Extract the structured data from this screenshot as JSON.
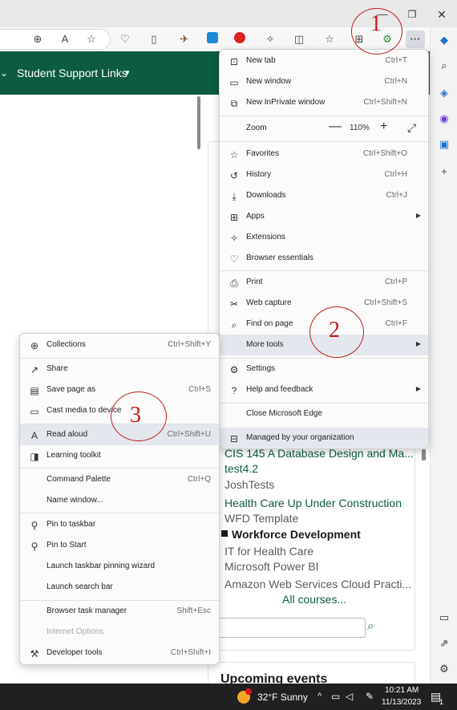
{
  "browser": {
    "toolbar_icons": [
      "zoom-icon",
      "read-aloud-icon",
      "favorite-star-icon",
      "pocket-icon",
      "reader-icon",
      "extension-icon",
      "extension-s-icon",
      "adblock-icon",
      "extensions-puzzle-icon",
      "split-screen-icon",
      "favorites-icon",
      "collections-icon",
      "profile-icon",
      "more-icon"
    ],
    "sidebar_icons": [
      "copilot-icon",
      "search-icon",
      "tag-icon",
      "office-icon",
      "outlook-icon",
      "add-icon",
      "sidebar-toggle-icon",
      "external-icon",
      "settings-icon"
    ],
    "more_button_label": "···"
  },
  "page": {
    "nav_link": "Student Support Links",
    "courses": [
      {
        "text": "CIS 145 A Database Design and Ma...",
        "style": "link"
      },
      {
        "text": "test4.2",
        "style": "link"
      },
      {
        "text": "JoshTests",
        "style": "gray"
      },
      {
        "text": "Health Care Up Under Construction",
        "style": "link"
      },
      {
        "text": "WFD Template",
        "style": "gray"
      },
      {
        "text": "Workforce Development",
        "style": "bold"
      },
      {
        "text": "IT for Health Care",
        "style": "gray"
      },
      {
        "text": "Microsoft Power BI",
        "style": "gray"
      },
      {
        "text": "Amazon Web Services Cloud Practi...",
        "style": "gray"
      }
    ],
    "all_courses": "All courses...",
    "upcoming_events": "Upcoming events"
  },
  "main_menu": {
    "new_tab": {
      "label": "New tab",
      "shortcut": "Ctrl+T"
    },
    "new_window": {
      "label": "New window",
      "shortcut": "Ctrl+N"
    },
    "new_inprivate": {
      "label": "New InPrivate window",
      "shortcut": "Ctrl+Shift+N"
    },
    "zoom": {
      "label": "Zoom",
      "value": "110%"
    },
    "favorites": {
      "label": "Favorites",
      "shortcut": "Ctrl+Shift+O"
    },
    "history": {
      "label": "History",
      "shortcut": "Ctrl+H"
    },
    "downloads": {
      "label": "Downloads",
      "shortcut": "Ctrl+J"
    },
    "apps": {
      "label": "Apps"
    },
    "extensions": {
      "label": "Extensions"
    },
    "browser_essentials": {
      "label": "Browser essentials"
    },
    "print": {
      "label": "Print",
      "shortcut": "Ctrl+P"
    },
    "web_capture": {
      "label": "Web capture",
      "shortcut": "Ctrl+Shift+S"
    },
    "find_on_page": {
      "label": "Find on page",
      "shortcut": "Ctrl+F"
    },
    "more_tools": {
      "label": "More tools"
    },
    "settings": {
      "label": "Settings"
    },
    "help_feedback": {
      "label": "Help and feedback"
    },
    "close_edge": {
      "label": "Close Microsoft Edge"
    },
    "managed": {
      "label": "Managed by your organization"
    }
  },
  "more_tools_menu": {
    "collections": {
      "label": "Collections",
      "shortcut": "Ctrl+Shift+Y"
    },
    "share": {
      "label": "Share"
    },
    "save_page": {
      "label": "Save page as",
      "shortcut": "Ctrl+S"
    },
    "cast": {
      "label": "Cast media to device"
    },
    "read_aloud": {
      "label": "Read aloud",
      "shortcut": "Ctrl+Shift+U"
    },
    "learning_toolkit": {
      "label": "Learning toolkit"
    },
    "command_palette": {
      "label": "Command Palette",
      "shortcut": "Ctrl+Q"
    },
    "name_window": {
      "label": "Name window..."
    },
    "pin_taskbar": {
      "label": "Pin to taskbar"
    },
    "pin_start": {
      "label": "Pin to Start"
    },
    "pin_wizard": {
      "label": "Launch taskbar pinning wizard"
    },
    "search_bar": {
      "label": "Launch search bar"
    },
    "task_manager": {
      "label": "Browser task manager",
      "shortcut": "Shift+Esc"
    },
    "internet_options": {
      "label": "Internet Options"
    },
    "dev_tools": {
      "label": "Developer tools",
      "shortcut": "Ctrl+Shift+I"
    }
  },
  "annotations": [
    "1",
    "2",
    "3"
  ],
  "taskbar": {
    "weather": "32°F  Sunny",
    "time": "10:21 AM",
    "date": "11/13/2023",
    "notification_count": "1"
  },
  "colors": {
    "brand_green": "#0e5c3f",
    "annotation_red": "#c21b1b",
    "menu_highlight": "#e4e8ee"
  }
}
